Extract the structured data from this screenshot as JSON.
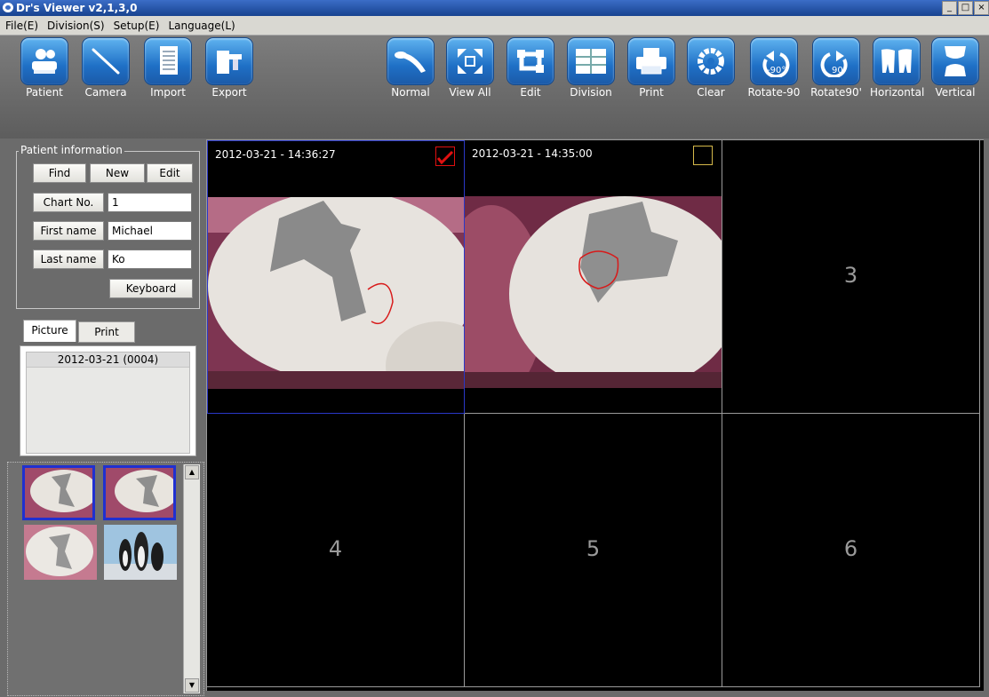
{
  "window": {
    "title": "Dr's Viewer v2,1,3,0",
    "controls": [
      "_",
      "□",
      "×"
    ]
  },
  "menu": [
    "File(E)",
    "Division(S)",
    "Setup(E)",
    "Language(L)"
  ],
  "toolbar": {
    "left": [
      {
        "label": "Patient",
        "icon": "patient-icon"
      },
      {
        "label": "Camera",
        "icon": "camera-icon"
      },
      {
        "label": "Import",
        "icon": "import-icon"
      },
      {
        "label": "Export",
        "icon": "export-icon"
      }
    ],
    "right": [
      {
        "label": "Normal",
        "icon": "normal-icon"
      },
      {
        "label": "View All",
        "icon": "view-all-icon"
      },
      {
        "label": "Edit",
        "icon": "edit-icon"
      },
      {
        "label": "Division",
        "icon": "division-icon"
      },
      {
        "label": "Print",
        "icon": "print-icon"
      },
      {
        "label": "Clear",
        "icon": "clear-icon"
      },
      {
        "label": "Rotate-90",
        "icon": "rotate-left-icon",
        "glyph": "-90°"
      },
      {
        "label": "Rotate90'",
        "icon": "rotate-right-icon",
        "glyph": "90°"
      },
      {
        "label": "Horizontal",
        "icon": "flip-horizontal-icon"
      },
      {
        "label": "Vertical",
        "icon": "flip-vertical-icon"
      }
    ]
  },
  "patient": {
    "legend": "Patient information",
    "find": "Find",
    "new": "New",
    "edit": "Edit",
    "chart_label": "Chart No.",
    "chart_value": "1",
    "first_label": "First name",
    "first_value": "Michael",
    "last_label": "Last name",
    "last_value": "Ko",
    "keyboard": "Keyboard"
  },
  "tabs": [
    "Picture",
    "Print"
  ],
  "picture_list": [
    "2012-03-21 (0004)"
  ],
  "cells": [
    {
      "stamp": "2012-03-21 - 14:36:27",
      "checked": true
    },
    {
      "stamp": "2012-03-21 - 14:35:00",
      "checked": false
    },
    {
      "number": "3"
    },
    {
      "number": "4"
    },
    {
      "number": "5"
    },
    {
      "number": "6"
    }
  ],
  "colors": {
    "accent": "#1f70c6",
    "selection": "#2030d0",
    "check": "#e01010"
  }
}
